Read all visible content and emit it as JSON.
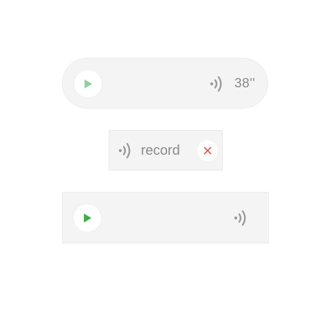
{
  "widgets": {
    "voice_message_pill": {
      "duration": "38''",
      "icons": [
        "play-icon",
        "sound-wave-icon"
      ],
      "play_color": "#8fd19e"
    },
    "record_chip": {
      "label": "record",
      "icons": [
        "sound-wave-icon",
        "close-icon"
      ],
      "close_color": "#e05a4f"
    },
    "voice_message_rect": {
      "icons": [
        "play-icon",
        "sound-wave-icon"
      ],
      "play_color": "#3fae4c"
    }
  },
  "colors": {
    "widget_background": "#f4f4f4",
    "icon_gray": "#9a9a9a",
    "text_gray": "#888888"
  }
}
